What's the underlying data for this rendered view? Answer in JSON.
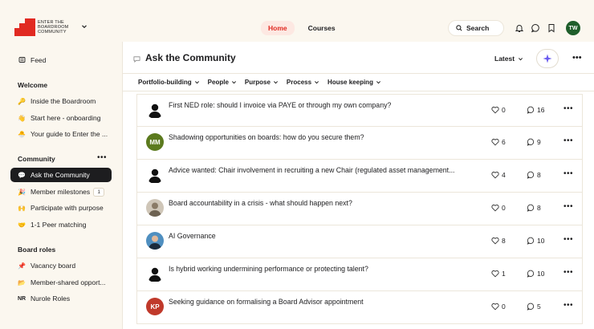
{
  "brand": {
    "logo_lines": [
      "ENTER THE",
      "BOARDROOM",
      "COMMUNITY"
    ],
    "accent": "#e12a22"
  },
  "nav": {
    "tabs": [
      {
        "label": "Home",
        "active": true
      },
      {
        "label": "Courses",
        "active": false
      }
    ]
  },
  "header": {
    "search_label": "Search",
    "icons": [
      "bell-icon",
      "chat-icon",
      "bookmark-icon"
    ],
    "user_initials": "TW"
  },
  "sidebar": {
    "feed": {
      "label": "Feed",
      "icon": "feed-icon"
    },
    "sections": [
      {
        "title": "Welcome",
        "items": [
          {
            "label": "Inside the Boardroom",
            "icon": "🔑"
          },
          {
            "label": "Start here - onboarding",
            "icon": "👋"
          },
          {
            "label": "Your guide to Enter the ...",
            "icon": "🐣"
          }
        ]
      },
      {
        "title": "Community",
        "items": [
          {
            "label": "Ask the Community",
            "icon": "💬",
            "active": true
          },
          {
            "label": "Member milestones",
            "icon": "🎉",
            "badge": "1"
          },
          {
            "label": "Participate with purpose",
            "icon": "🙌"
          },
          {
            "label": "1-1 Peer matching",
            "icon": "🤝"
          }
        ]
      },
      {
        "title": "Board roles",
        "items": [
          {
            "label": "Vacancy board",
            "icon": "📌"
          },
          {
            "label": "Member-shared opport...",
            "icon": "📂"
          },
          {
            "label": "Nurole Roles",
            "icon": "NR"
          }
        ]
      }
    ]
  },
  "main": {
    "title": "Ask the Community",
    "sort": "Latest",
    "filters": [
      "Portfolio-building",
      "People",
      "Purpose",
      "Process",
      "House keeping"
    ],
    "posts": [
      {
        "title": "First NED role: should I invoice via PAYE or through my own company?",
        "likes": "0",
        "comments": "16",
        "avatar": "silhouette"
      },
      {
        "title": "Shadowing opportunities on boards: how do you secure them?",
        "likes": "6",
        "comments": "9",
        "avatar": "initials",
        "initials": "MM",
        "color": "#5b7a1e"
      },
      {
        "title": "Advice wanted: Chair involvement in recruiting a new Chair (regulated asset management...",
        "likes": "4",
        "comments": "8",
        "avatar": "silhouette"
      },
      {
        "title": "Board accountability in a crisis - what should happen next?",
        "likes": "0",
        "comments": "8",
        "avatar": "photo"
      },
      {
        "title": "AI Governance",
        "likes": "8",
        "comments": "10",
        "avatar": "photo2"
      },
      {
        "title": "Is hybrid working undermining performance or protecting talent?",
        "likes": "1",
        "comments": "10",
        "avatar": "silhouette"
      },
      {
        "title": "Seeking guidance on formalising a Board Advisor appointment",
        "likes": "0",
        "comments": "5",
        "avatar": "initials",
        "initials": "KP",
        "color": "#c0392b"
      }
    ]
  }
}
